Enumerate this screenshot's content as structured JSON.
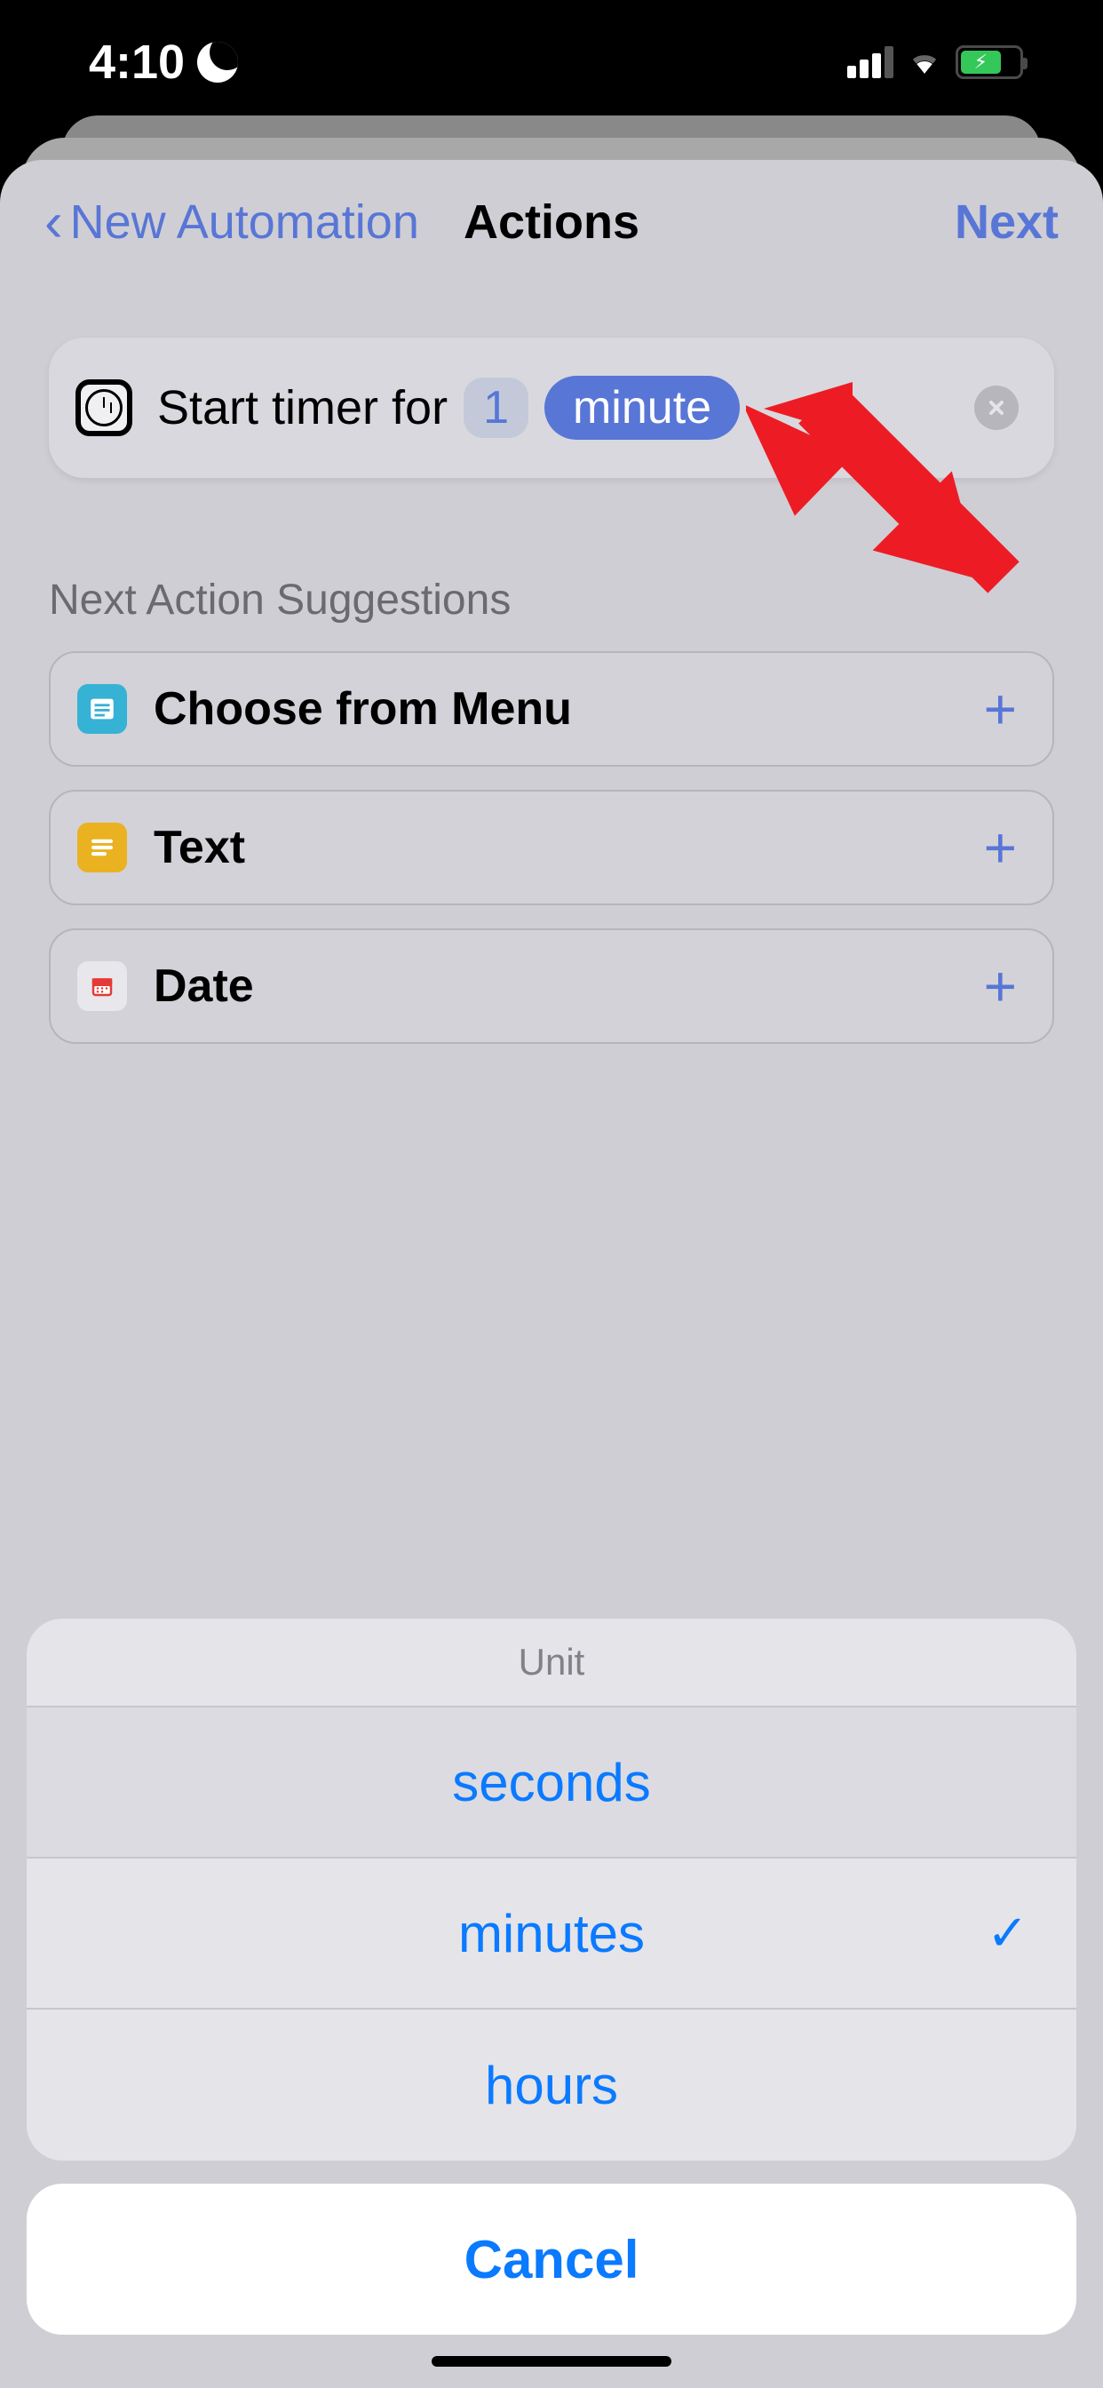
{
  "status_bar": {
    "time": "4:10"
  },
  "nav": {
    "back_label": "New Automation",
    "title": "Actions",
    "next_label": "Next"
  },
  "action": {
    "prefix": "Start timer for",
    "number": "1",
    "unit": "minute"
  },
  "suggestions": {
    "header": "Next Action Suggestions",
    "items": [
      {
        "label": "Choose from Menu"
      },
      {
        "label": "Text"
      },
      {
        "label": "Date"
      }
    ]
  },
  "sheet": {
    "title": "Unit",
    "options": [
      {
        "label": "seconds",
        "checked": false
      },
      {
        "label": "minutes",
        "checked": true
      },
      {
        "label": "hours",
        "checked": false
      }
    ],
    "cancel": "Cancel"
  }
}
